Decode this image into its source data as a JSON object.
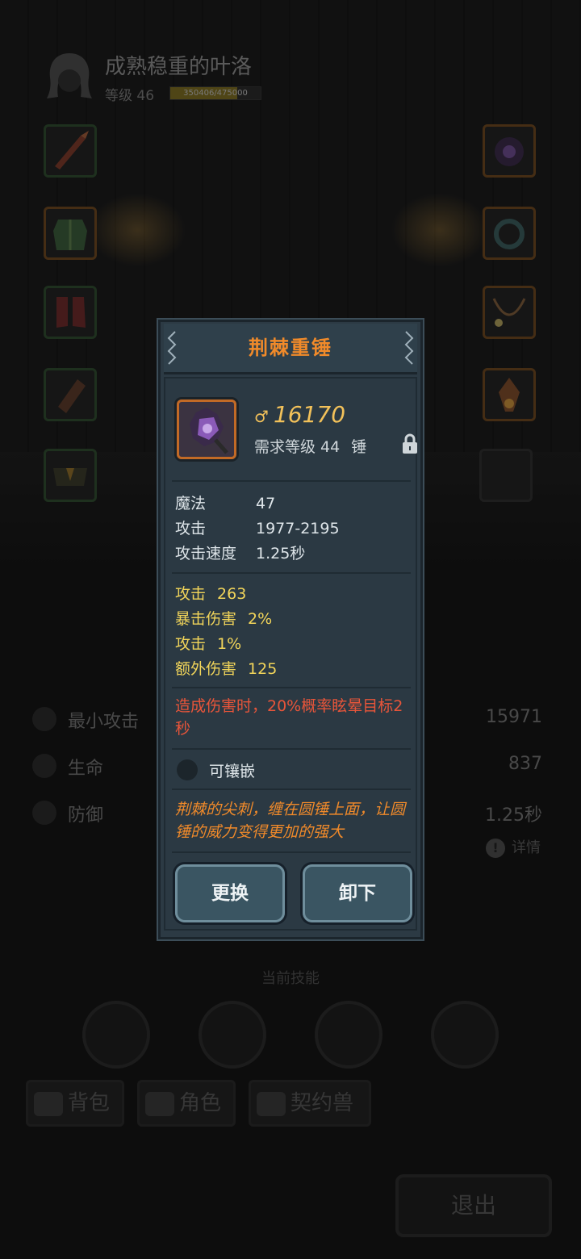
{
  "hero": {
    "name": "成熟稳重的叶洛",
    "level_label": "等级 46",
    "xp_text": "350406/475000",
    "xp_progress": 0.7377
  },
  "equipment_slots": {
    "left": [
      "weapon-slot",
      "armor-slot",
      "boots-slot",
      "bracer-slot",
      "belt-slot"
    ],
    "right": [
      "helmet-slot",
      "ring-slot",
      "necklace-slot",
      "amulet-slot"
    ]
  },
  "stats": [
    {
      "icon": "sword-icon",
      "label": "最小攻击",
      "value": "15971"
    },
    {
      "icon": "heart-icon",
      "label": "生命",
      "value": "837"
    },
    {
      "icon": "shield-icon",
      "label": "防御",
      "value": "1.25秒"
    }
  ],
  "detail_link": "详情",
  "skills_title": "当前技能",
  "tabs": [
    {
      "icon": "bag-icon",
      "label": "背包"
    },
    {
      "icon": "character-icon",
      "label": "角色"
    },
    {
      "icon": "paw-icon",
      "label": "契约兽"
    }
  ],
  "exit_label": "退出",
  "popup": {
    "title": "荆棘重锤",
    "power": "16170",
    "required_level": "需求等级 44",
    "item_type": "锤",
    "base_stats": [
      {
        "label": "魔法",
        "value": "47"
      },
      {
        "label": "攻击",
        "value": "1977-2195"
      },
      {
        "label": "攻击速度",
        "value": "1.25秒"
      }
    ],
    "bonus_stats": [
      {
        "label": "攻击",
        "value": "263"
      },
      {
        "label": "暴击伤害",
        "value": "2%"
      },
      {
        "label": "攻击",
        "value": "1%"
      },
      {
        "label": "额外伤害",
        "value": "125"
      }
    ],
    "special_effect": "造成伤害时，20%概率眩晕目标2秒",
    "socket_label": "可镶嵌",
    "description": "荆棘的尖刺，缠在圆锤上面，让圆锤的威力变得更加的强大",
    "replace_label": "更换",
    "unequip_label": "卸下"
  },
  "colors": {
    "title_orange": "#f08a2a",
    "bonus_yellow": "#f2d55a",
    "effect_red": "#e8553a",
    "panel": "#2c3a44"
  }
}
